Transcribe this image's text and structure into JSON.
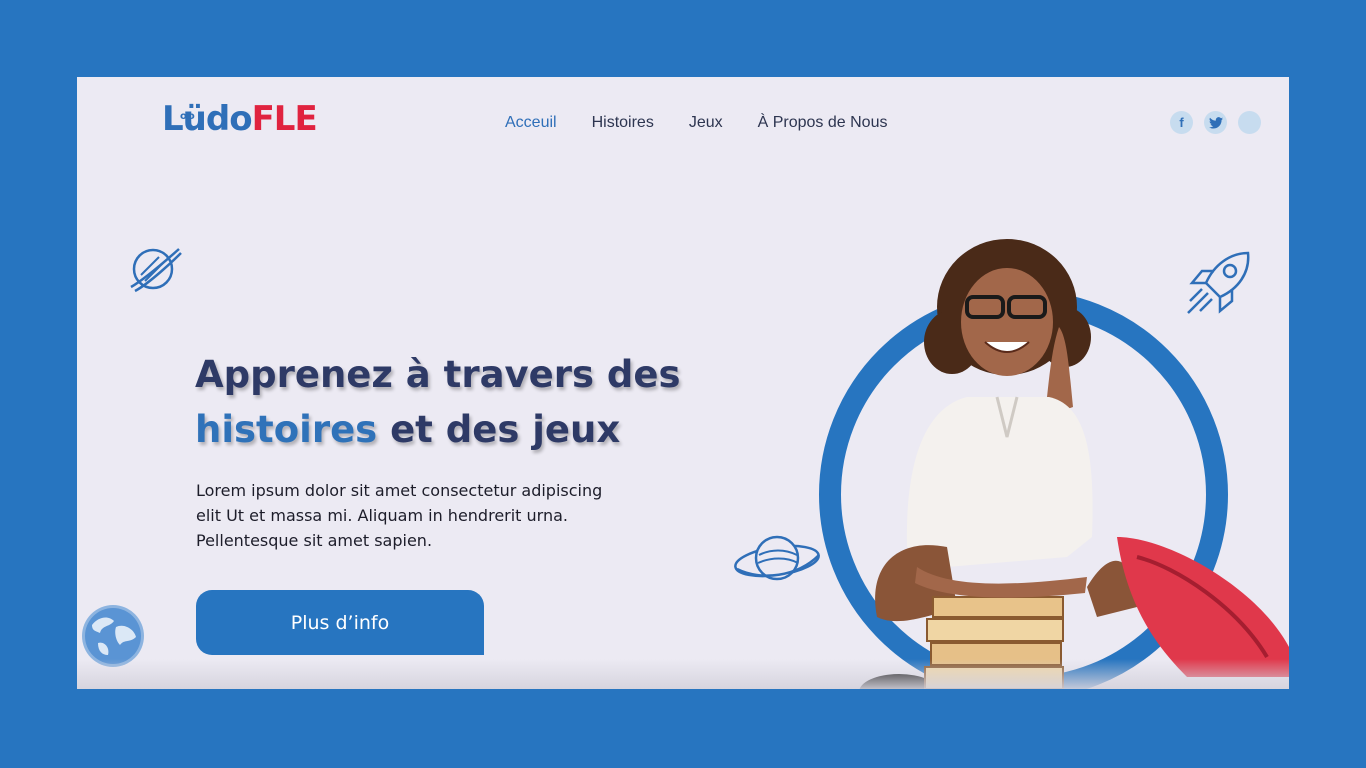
{
  "logo": {
    "part1": "Lüdo",
    "part2": "FLE",
    "eyes": "oo"
  },
  "nav": {
    "items": [
      {
        "label": "Acceuil",
        "active": true
      },
      {
        "label": "Histoires",
        "active": false
      },
      {
        "label": "Jeux",
        "active": false
      },
      {
        "label": "À Propos de Nous",
        "active": false
      }
    ]
  },
  "social": {
    "facebook": "f",
    "twitter": "🐦",
    "extra": ""
  },
  "hero": {
    "title_line1": "Apprenez  à travers des",
    "title_line2_a": "histoires",
    "title_line2_b": " et des jeux",
    "text": "Lorem ipsum dolor sit amet consectetur adipiscing elit Ut et massa mi. Aliquam in hendrerit urna. Pellentesque sit amet sapien.",
    "cta_label": "Plus d’info"
  },
  "colors": {
    "brand_blue": "#2775c0",
    "accent_red": "#e0233f",
    "background": "#eceaf3"
  },
  "icons": [
    "planet-icon",
    "rocket-icon",
    "globe-icon",
    "facebook-icon",
    "twitter-icon"
  ]
}
